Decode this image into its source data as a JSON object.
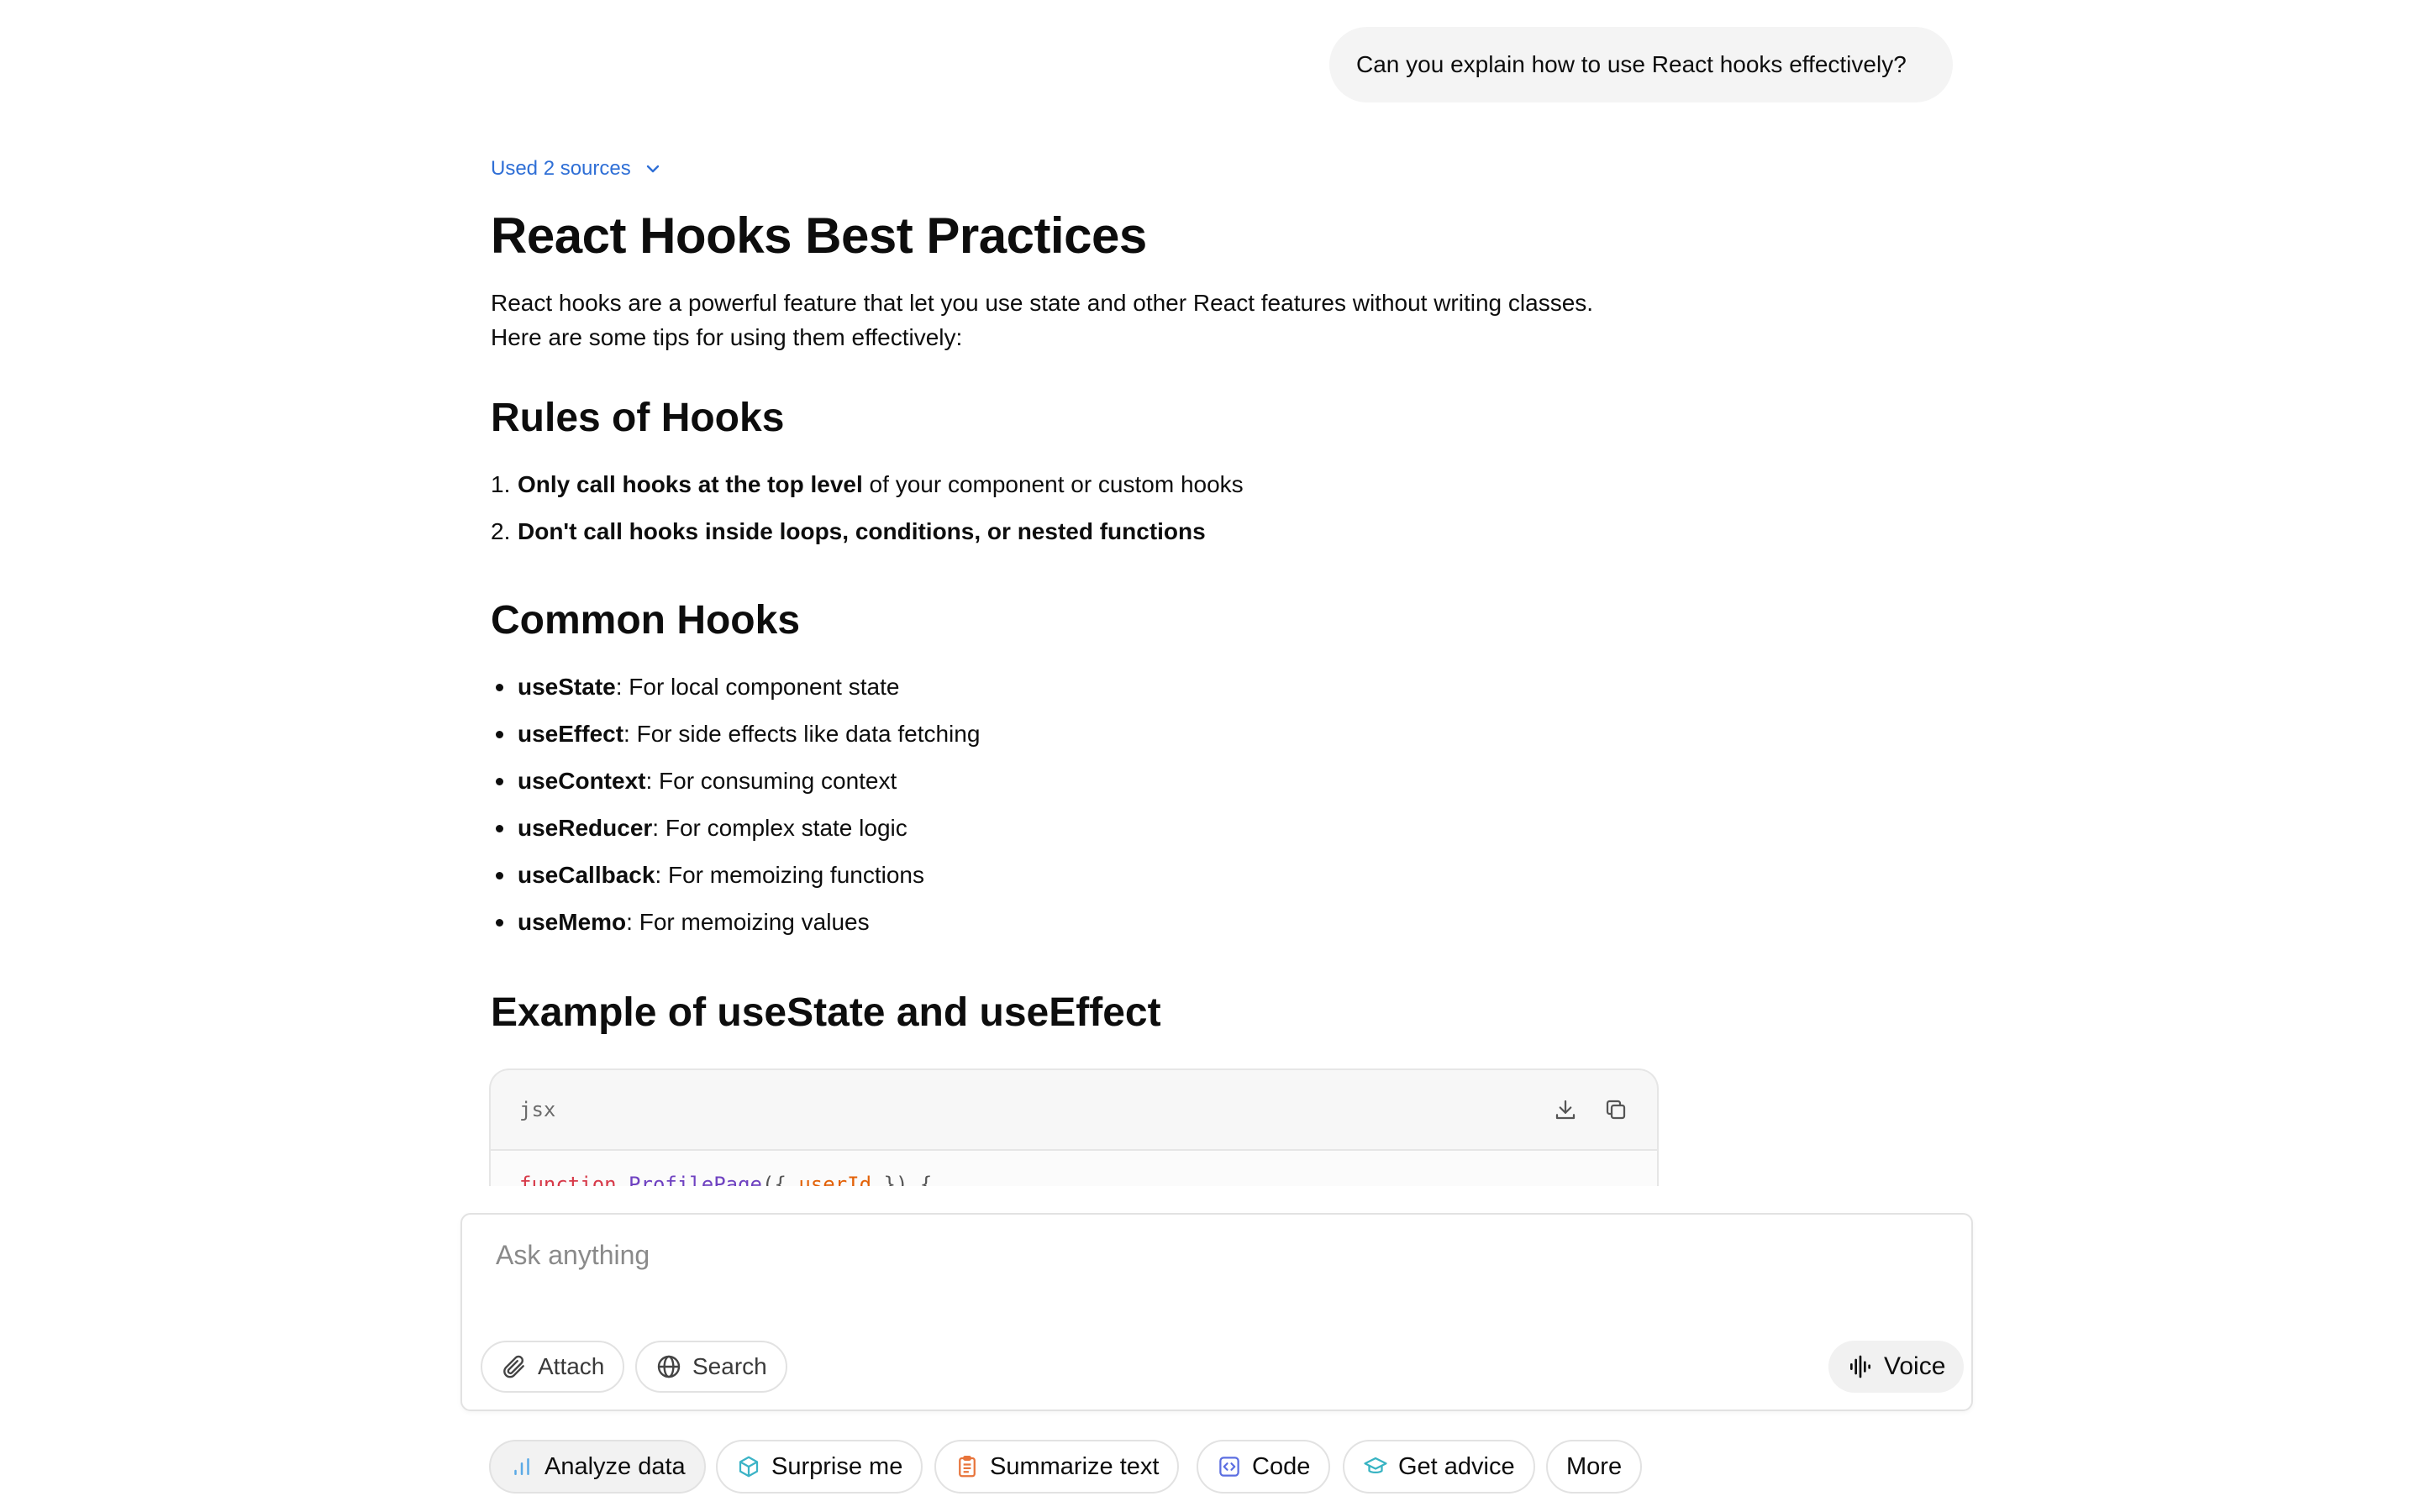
{
  "user_message": "Can you explain how to use React hooks effectively?",
  "sources_label": "Used 2 sources",
  "answer": {
    "title": "React Hooks Best Practices",
    "intro_line1": "React hooks are a powerful feature that let you use state and other React features without writing classes.",
    "intro_line2": "Here are some tips for using them effectively:",
    "rules": {
      "heading": "Rules of Hooks",
      "items": [
        {
          "num": "1.",
          "bold": "Only call hooks at the top level",
          "rest": " of your component or custom hooks"
        },
        {
          "num": "2.",
          "bold": "Don't call hooks inside loops, conditions, or nested functions",
          "rest": ""
        }
      ]
    },
    "common": {
      "heading": "Common Hooks",
      "items": [
        {
          "bold": "useState",
          "rest": ": For local component state"
        },
        {
          "bold": "useEffect",
          "rest": ": For side effects like data fetching"
        },
        {
          "bold": "useContext",
          "rest": ": For consuming context"
        },
        {
          "bold": "useReducer",
          "rest": ": For complex state logic"
        },
        {
          "bold": "useCallback",
          "rest": ": For memoizing functions"
        },
        {
          "bold": "useMemo",
          "rest": ": For memoizing values"
        }
      ]
    },
    "example": {
      "heading": "Example of useState and useEffect",
      "code_lang": "jsx",
      "code_line": {
        "kw": "function ",
        "fn": "ProfilePage",
        "p1": "({ ",
        "prop": "userId",
        "p2": " }) {"
      }
    }
  },
  "composer": {
    "placeholder": "Ask anything",
    "attach_label": "Attach",
    "search_label": "Search",
    "voice_label": "Voice"
  },
  "suggestions": [
    {
      "label": "Analyze data",
      "icon": "bar-chart-icon",
      "color": "#5aa9e6"
    },
    {
      "label": "Surprise me",
      "icon": "cube-icon",
      "color": "#3bb3c6"
    },
    {
      "label": "Summarize text",
      "icon": "clipboard-icon",
      "color": "#e8743b"
    },
    {
      "label": "Code",
      "icon": "code-icon",
      "color": "#5b6ee1"
    },
    {
      "label": "Get advice",
      "icon": "graduation-cap-icon",
      "color": "#38b3c2"
    },
    {
      "label": "More",
      "icon": "",
      "color": ""
    }
  ]
}
